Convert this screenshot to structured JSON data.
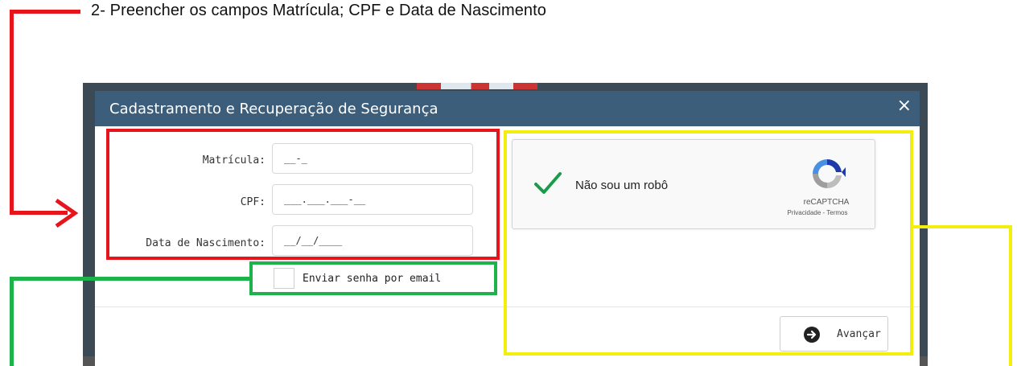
{
  "caption": "2-   Preencher os campos Matrícula; CPF e Data de Nascimento",
  "modal": {
    "title": "Cadastramento e Recuperação de Segurança",
    "close": "×"
  },
  "form": {
    "matricula": {
      "label": "Matrícula:",
      "value": "__-_"
    },
    "cpf": {
      "label": "CPF:",
      "value": "___.___.___-__"
    },
    "nascimento": {
      "label": "Data de Nascimento:",
      "value": "__/__/____"
    },
    "email_checkbox": {
      "label": "Enviar senha por email",
      "checked": false
    }
  },
  "captcha": {
    "text": "Não sou um robô",
    "brand": "reCAPTCHA",
    "links": "Privacidade - Termos"
  },
  "actions": {
    "next": "Avançar"
  },
  "colors": {
    "header": "#3d5e7a",
    "annotation_red": "#e8141b",
    "annotation_green": "#1db24a",
    "annotation_yellow": "#f2ee10",
    "captcha_check": "#199c4a"
  }
}
